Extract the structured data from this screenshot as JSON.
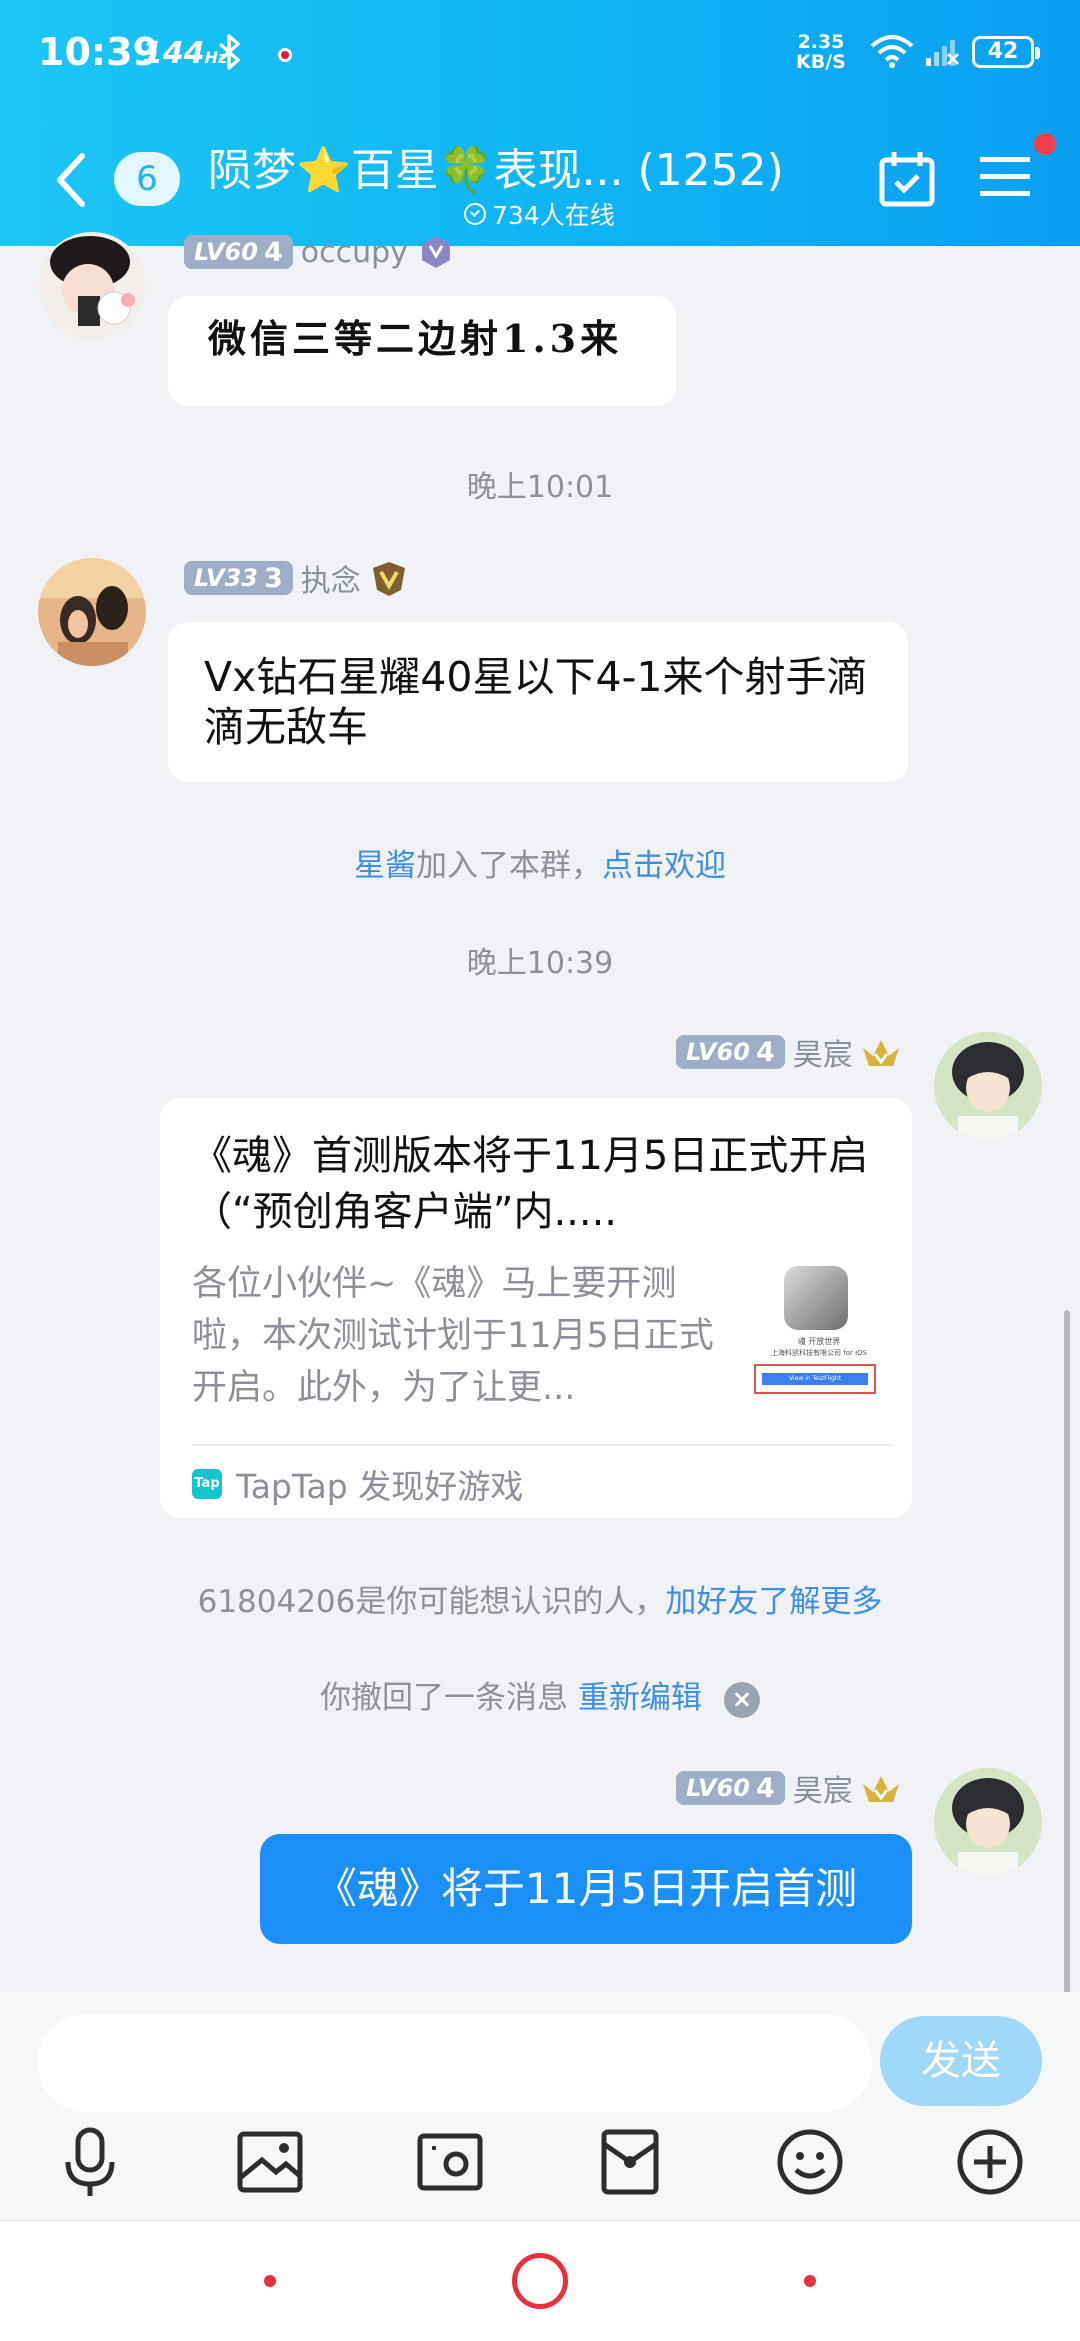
{
  "status_bar": {
    "time": "10:39",
    "refresh_rate": "144",
    "refresh_unit": "Hz",
    "net_speed_value": "2.35",
    "net_speed_unit": "KB/S",
    "battery": "42"
  },
  "header": {
    "unread_count": "6",
    "group_title": "陨梦⭐百星🍀表现... (1252)",
    "online": "734人在线",
    "accent_color": "#12b7f5"
  },
  "messages": {
    "m1": {
      "level": "LV60",
      "level_num": "4",
      "nick": "occupy",
      "text": "微信三等二边射1.3来"
    },
    "time1": "晚上10:01",
    "m2": {
      "level": "LV33",
      "level_num": "3",
      "nick": "执念",
      "text": "Vx钻石星耀40星以下4-1来个射手滴滴无敌车"
    },
    "join": {
      "name": "星酱",
      "text": "加入了本群，",
      "action": "点击欢迎"
    },
    "time2": "晚上10:39",
    "m3": {
      "level": "LV60",
      "level_num": "4",
      "nick": "昊宸",
      "card_title": "《魂》首测版本将于11月5日正式开启（“预创角客户端”内.....",
      "card_desc": "各位小伙伴~《魂》马上要开测啦，本次测试计划于11月5日正式开启。此外，为了让更...",
      "thumb_caption": "魂 开放世界",
      "thumb_company": "上海科凯科技有限公司 for iOS",
      "thumb_button": "View in TestFlight",
      "tap_logo": "Tap",
      "source": "TapTap 发现好游戏"
    },
    "suggest": {
      "text": "61804206是你可能想认识的人，",
      "action": "加好友了解更多"
    },
    "retract": {
      "text": "你撤回了一条消息 ",
      "action": "重新编辑"
    },
    "m4": {
      "level": "LV60",
      "level_num": "4",
      "nick": "昊宸",
      "text": "《魂》将于11月5日开启首测"
    }
  },
  "input": {
    "placeholder": "",
    "send_label": "发送",
    "send_color": "#9fd8f8"
  },
  "toolbar": {
    "icons": [
      "microphone-icon",
      "image-icon",
      "camera-icon",
      "red-packet-icon",
      "emoji-icon",
      "plus-icon"
    ]
  },
  "nav": {
    "accent_color": "#e8303c"
  }
}
